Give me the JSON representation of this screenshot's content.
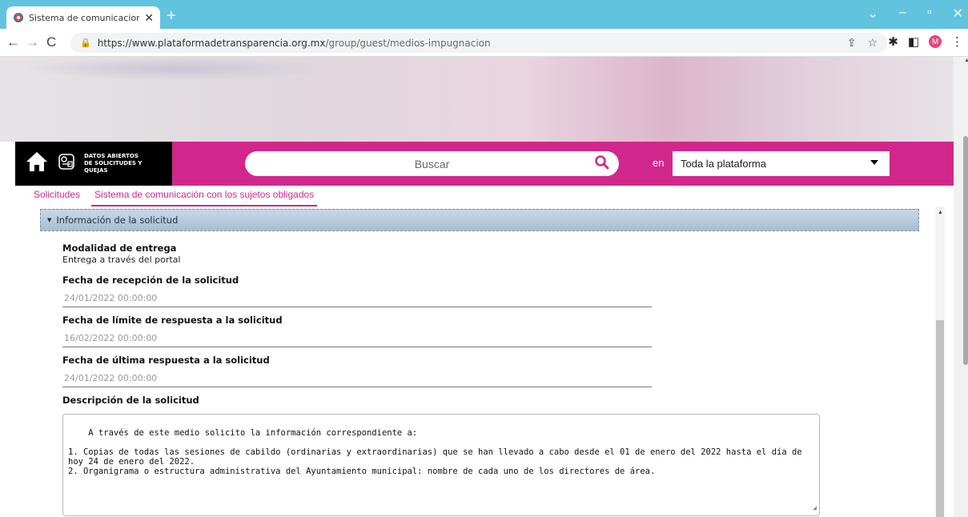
{
  "browser": {
    "tab_title": "Sistema de comunicacion con los",
    "url_host": "https://www.plataformadetransparencia.org.mx",
    "url_path": "/group/guest/medios-impugnacion",
    "avatar_letter": "M",
    "new_tab_symbol": "+",
    "close_symbol": "✕"
  },
  "site": {
    "logo_text": "DATOS ABIERTOS DE SOLICITUDES Y QUEJAS",
    "search_placeholder": "Buscar",
    "scope_label": "en",
    "scope_value": "Toda la plataforma",
    "accent_color": "#d1278c"
  },
  "subtabs": [
    {
      "label": "Solicitudes"
    },
    {
      "label": "Sistema de comunicación con los sujetos obligados"
    }
  ],
  "section": {
    "title": "Información de la solicitud",
    "fields": {
      "modalidad_label": "Modalidad de entrega",
      "modalidad_value": "Entrega a través del portal",
      "recepcion_label": "Fecha de recepción de la solicitud",
      "recepcion_value": "24/01/2022 00:00:00",
      "limite_label": "Fecha de límite de respuesta a la solicitud",
      "limite_value": "16/02/2022 00:00:00",
      "ultima_label": "Fecha de última respuesta a la solicitud",
      "ultima_value": "24/01/2022 00:00:00",
      "descripcion_label": "Descripción de la solicitud",
      "descripcion_value": "A través de este medio solicito la información correspondiente a:\n\n1. Copias de todas las sesiones de cabildo (ordinarias y extraordinarias) que se han llevado a cabo desde el 01 de enero del 2022 hasta el día de hoy 24 de enero del 2022.\n2. Organigrama o estructura administrativa del Ayuntamiento municipal: nombre de cada uno de los directores de área."
    }
  },
  "icons": {
    "home": "home-icon",
    "search": "search-icon",
    "tab_favicon": "favicon-icon"
  }
}
